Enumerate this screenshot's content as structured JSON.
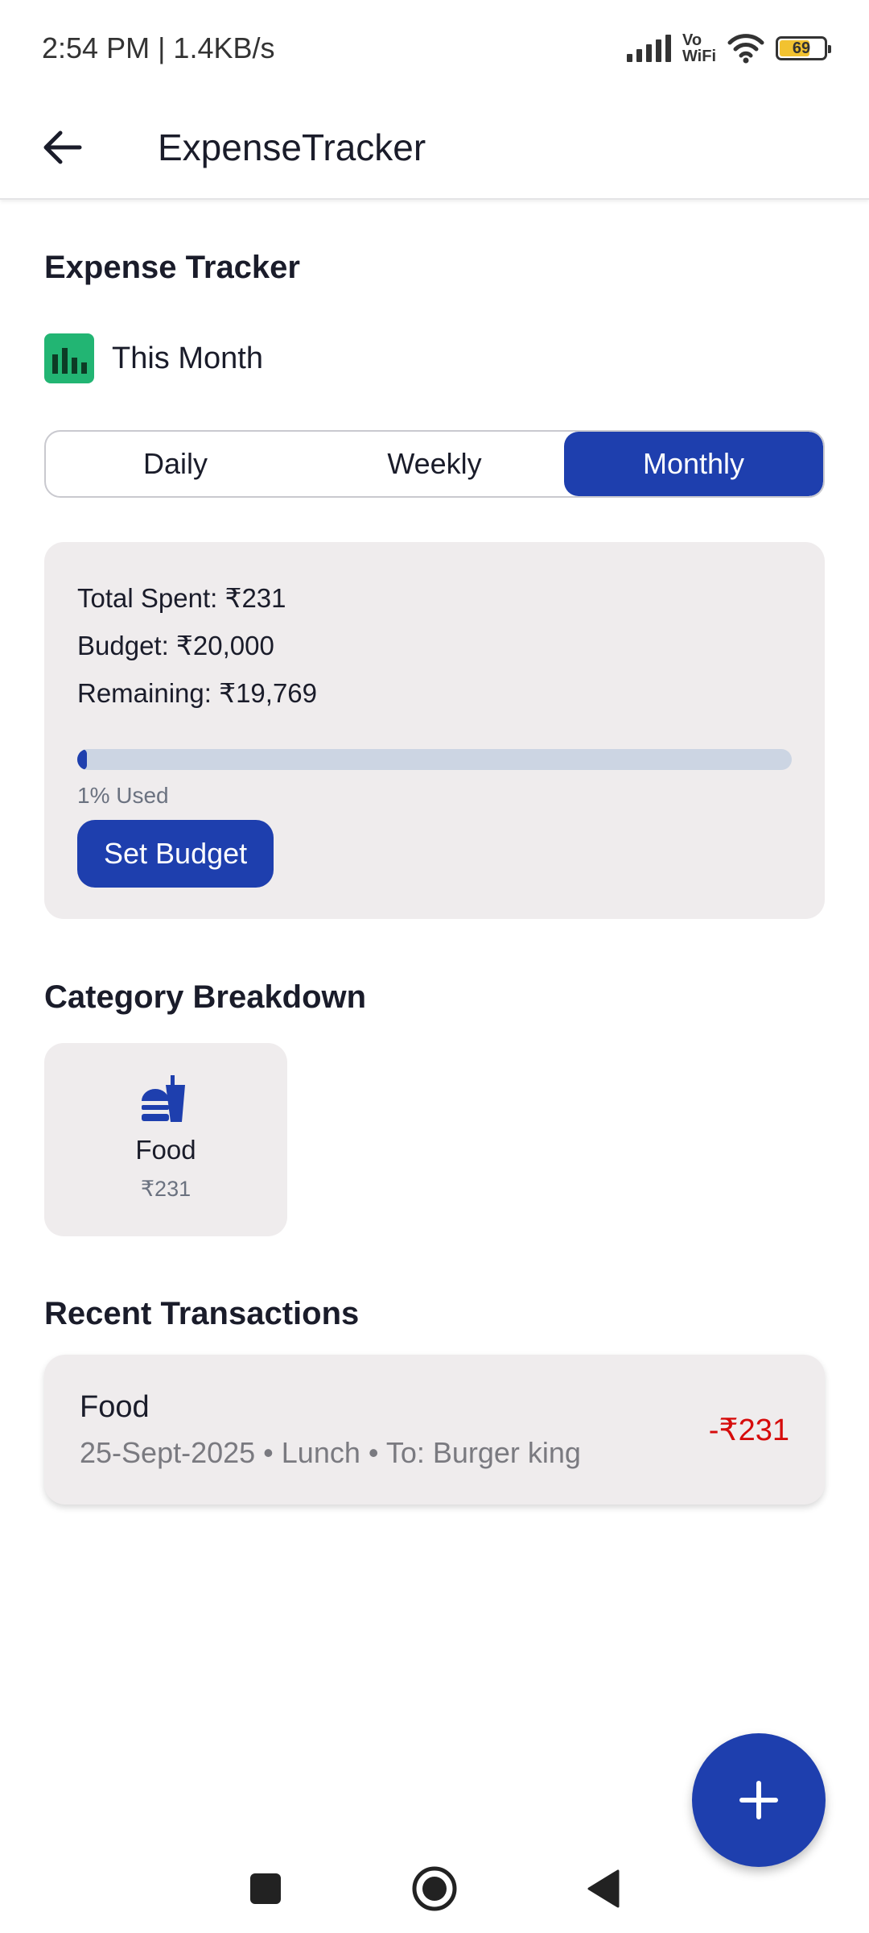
{
  "status_bar": {
    "time_speed": "2:54 PM | 1.4KB/s",
    "vowifi_top": "Vo",
    "vowifi_bottom": "WiFi",
    "battery_level": "69"
  },
  "app_bar": {
    "title": "ExpenseTracker",
    "back_icon": "arrow-left-icon"
  },
  "header": {
    "title": "Expense Tracker",
    "period_icon": "bar-chart-icon",
    "period_label": "This Month"
  },
  "period_tabs": [
    {
      "label": "Daily",
      "active": false
    },
    {
      "label": "Weekly",
      "active": false
    },
    {
      "label": "Monthly",
      "active": true
    }
  ],
  "budget": {
    "total_spent": "Total Spent: ₹231",
    "budget": "Budget: ₹20,000",
    "remaining": "Remaining: ₹19,769",
    "used_fraction": 0.01,
    "used_label": "1% Used",
    "set_budget_label": "Set Budget"
  },
  "category_breakdown": {
    "title": "Category Breakdown",
    "items": [
      {
        "icon": "fastfood-icon",
        "name": "Food",
        "amount": "₹231"
      }
    ]
  },
  "recent_transactions": {
    "title": "Recent Transactions",
    "items": [
      {
        "title": "Food",
        "meta": "25-Sept-2025 • Lunch • To: Burger king",
        "amount": "-₹231"
      }
    ]
  },
  "fab": {
    "icon": "plus-icon"
  },
  "colors": {
    "primary": "#1e3fae",
    "card_bg": "#efeced",
    "negative": "#d60b0b",
    "period_icon_bg": "#22b573"
  }
}
